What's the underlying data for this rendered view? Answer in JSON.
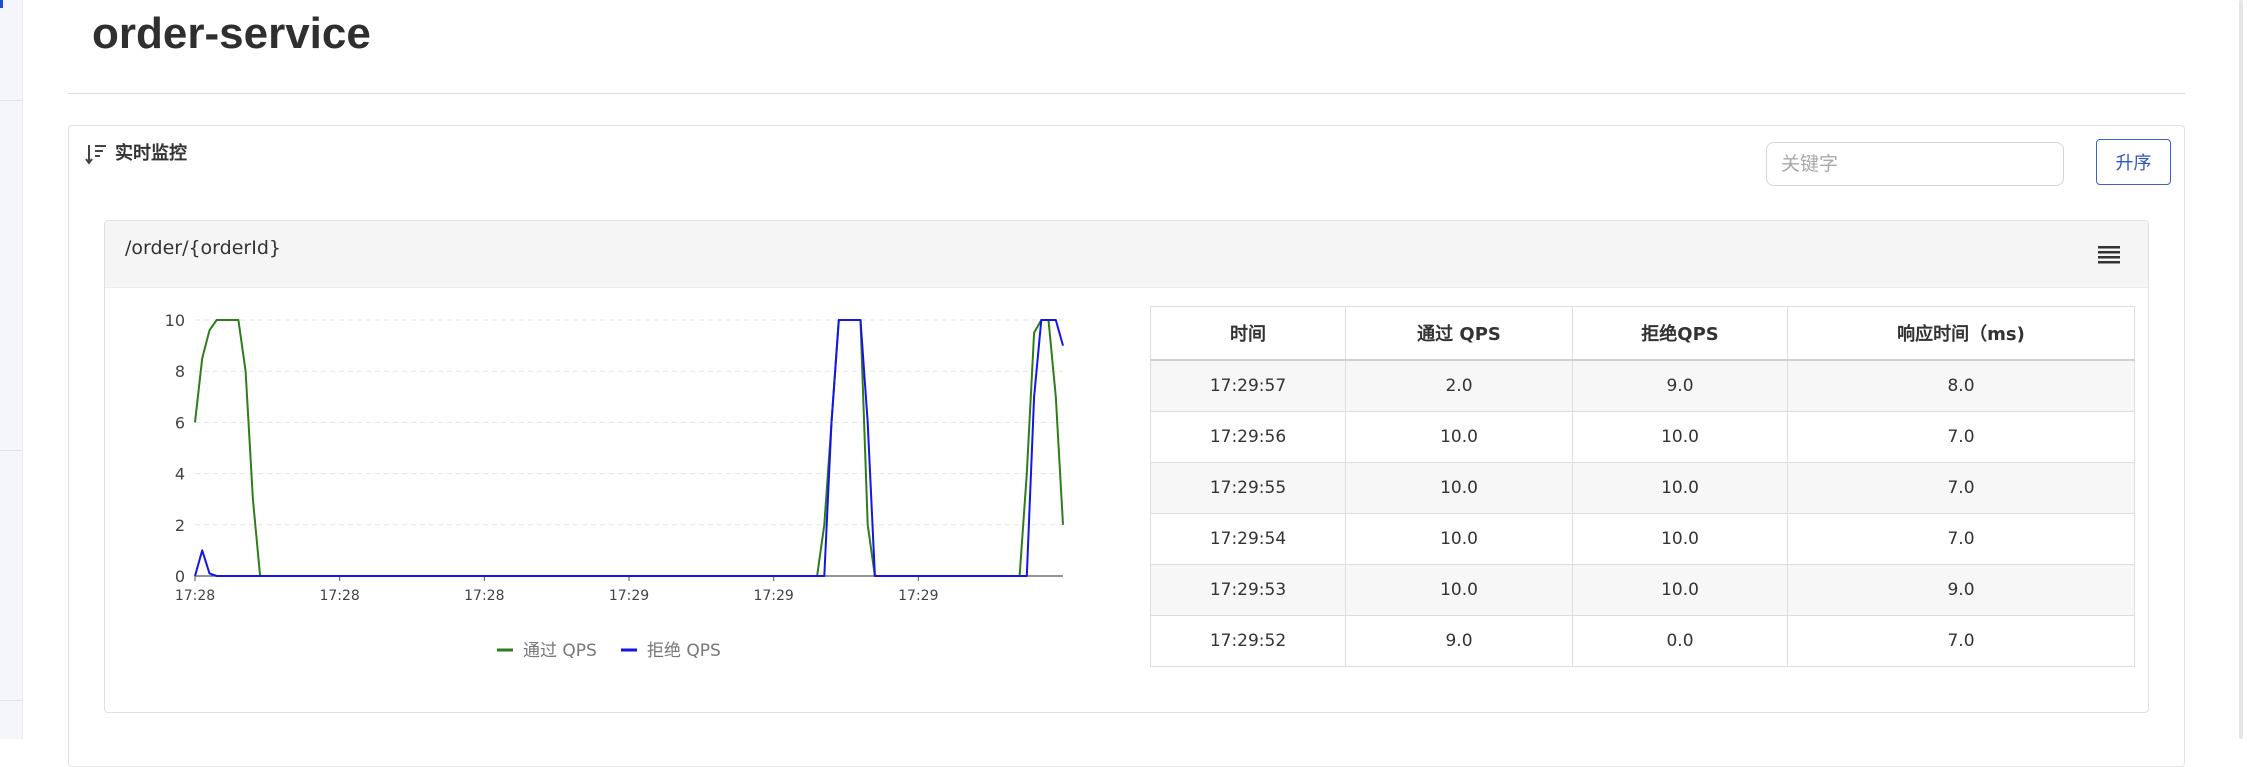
{
  "page": {
    "title": "order-service"
  },
  "panel": {
    "title": "实时监控",
    "header_icon": "sort-lines-icon",
    "search": {
      "placeholder": "关键字",
      "value": ""
    },
    "sort_button_label": "升序"
  },
  "card": {
    "title": "/order/{orderId}",
    "menu_icon": "hamburger-menu-icon"
  },
  "chart_data": {
    "type": "line",
    "title": "",
    "xlabel": "",
    "ylabel": "",
    "x_ticks": [
      "17:28",
      "17:28",
      "17:28",
      "17:29",
      "17:29",
      "17:29"
    ],
    "y_ticks": [
      0,
      2,
      4,
      6,
      8,
      10
    ],
    "ylim": [
      0,
      10
    ],
    "xlim": [
      0,
      60
    ],
    "grid": true,
    "legend_placement": "bottom-center",
    "series": [
      {
        "name": "通过 QPS",
        "color": "#2e7d1a",
        "x": [
          0,
          0.5,
          1,
          1.5,
          2,
          3,
          3.5,
          4,
          4.5,
          5,
          6,
          43,
          43.5,
          44,
          44.5,
          45,
          45.5,
          46,
          46.5,
          47,
          57,
          57.5,
          58,
          58.5,
          59,
          59.5,
          60
        ],
        "values": [
          6,
          8.5,
          9.6,
          10,
          10,
          10,
          8,
          3,
          0,
          0,
          0,
          0,
          2,
          6,
          10,
          10,
          10,
          10,
          2,
          0,
          0,
          4,
          9.5,
          10,
          10,
          7,
          2
        ]
      },
      {
        "name": "拒绝 QPS",
        "color": "#1515e6",
        "x": [
          0,
          0.5,
          1,
          1.5,
          2,
          43.5,
          44,
          44.5,
          45,
          45.5,
          46,
          46.5,
          47,
          57.5,
          58,
          58.5,
          59,
          59.5,
          60
        ],
        "values": [
          0,
          1,
          0.1,
          0,
          0,
          0,
          6,
          10,
          10,
          10,
          10,
          6,
          0,
          0,
          7,
          10,
          10,
          10,
          9
        ]
      }
    ]
  },
  "table": {
    "headers": [
      "时间",
      "通过 QPS",
      "拒绝QPS",
      "响应时间（ms)"
    ],
    "rows": [
      [
        "17:29:57",
        "2.0",
        "9.0",
        "8.0"
      ],
      [
        "17:29:56",
        "10.0",
        "10.0",
        "7.0"
      ],
      [
        "17:29:55",
        "10.0",
        "10.0",
        "7.0"
      ],
      [
        "17:29:54",
        "10.0",
        "10.0",
        "7.0"
      ],
      [
        "17:29:53",
        "10.0",
        "10.0",
        "9.0"
      ],
      [
        "17:29:52",
        "9.0",
        "0.0",
        "7.0"
      ]
    ]
  }
}
